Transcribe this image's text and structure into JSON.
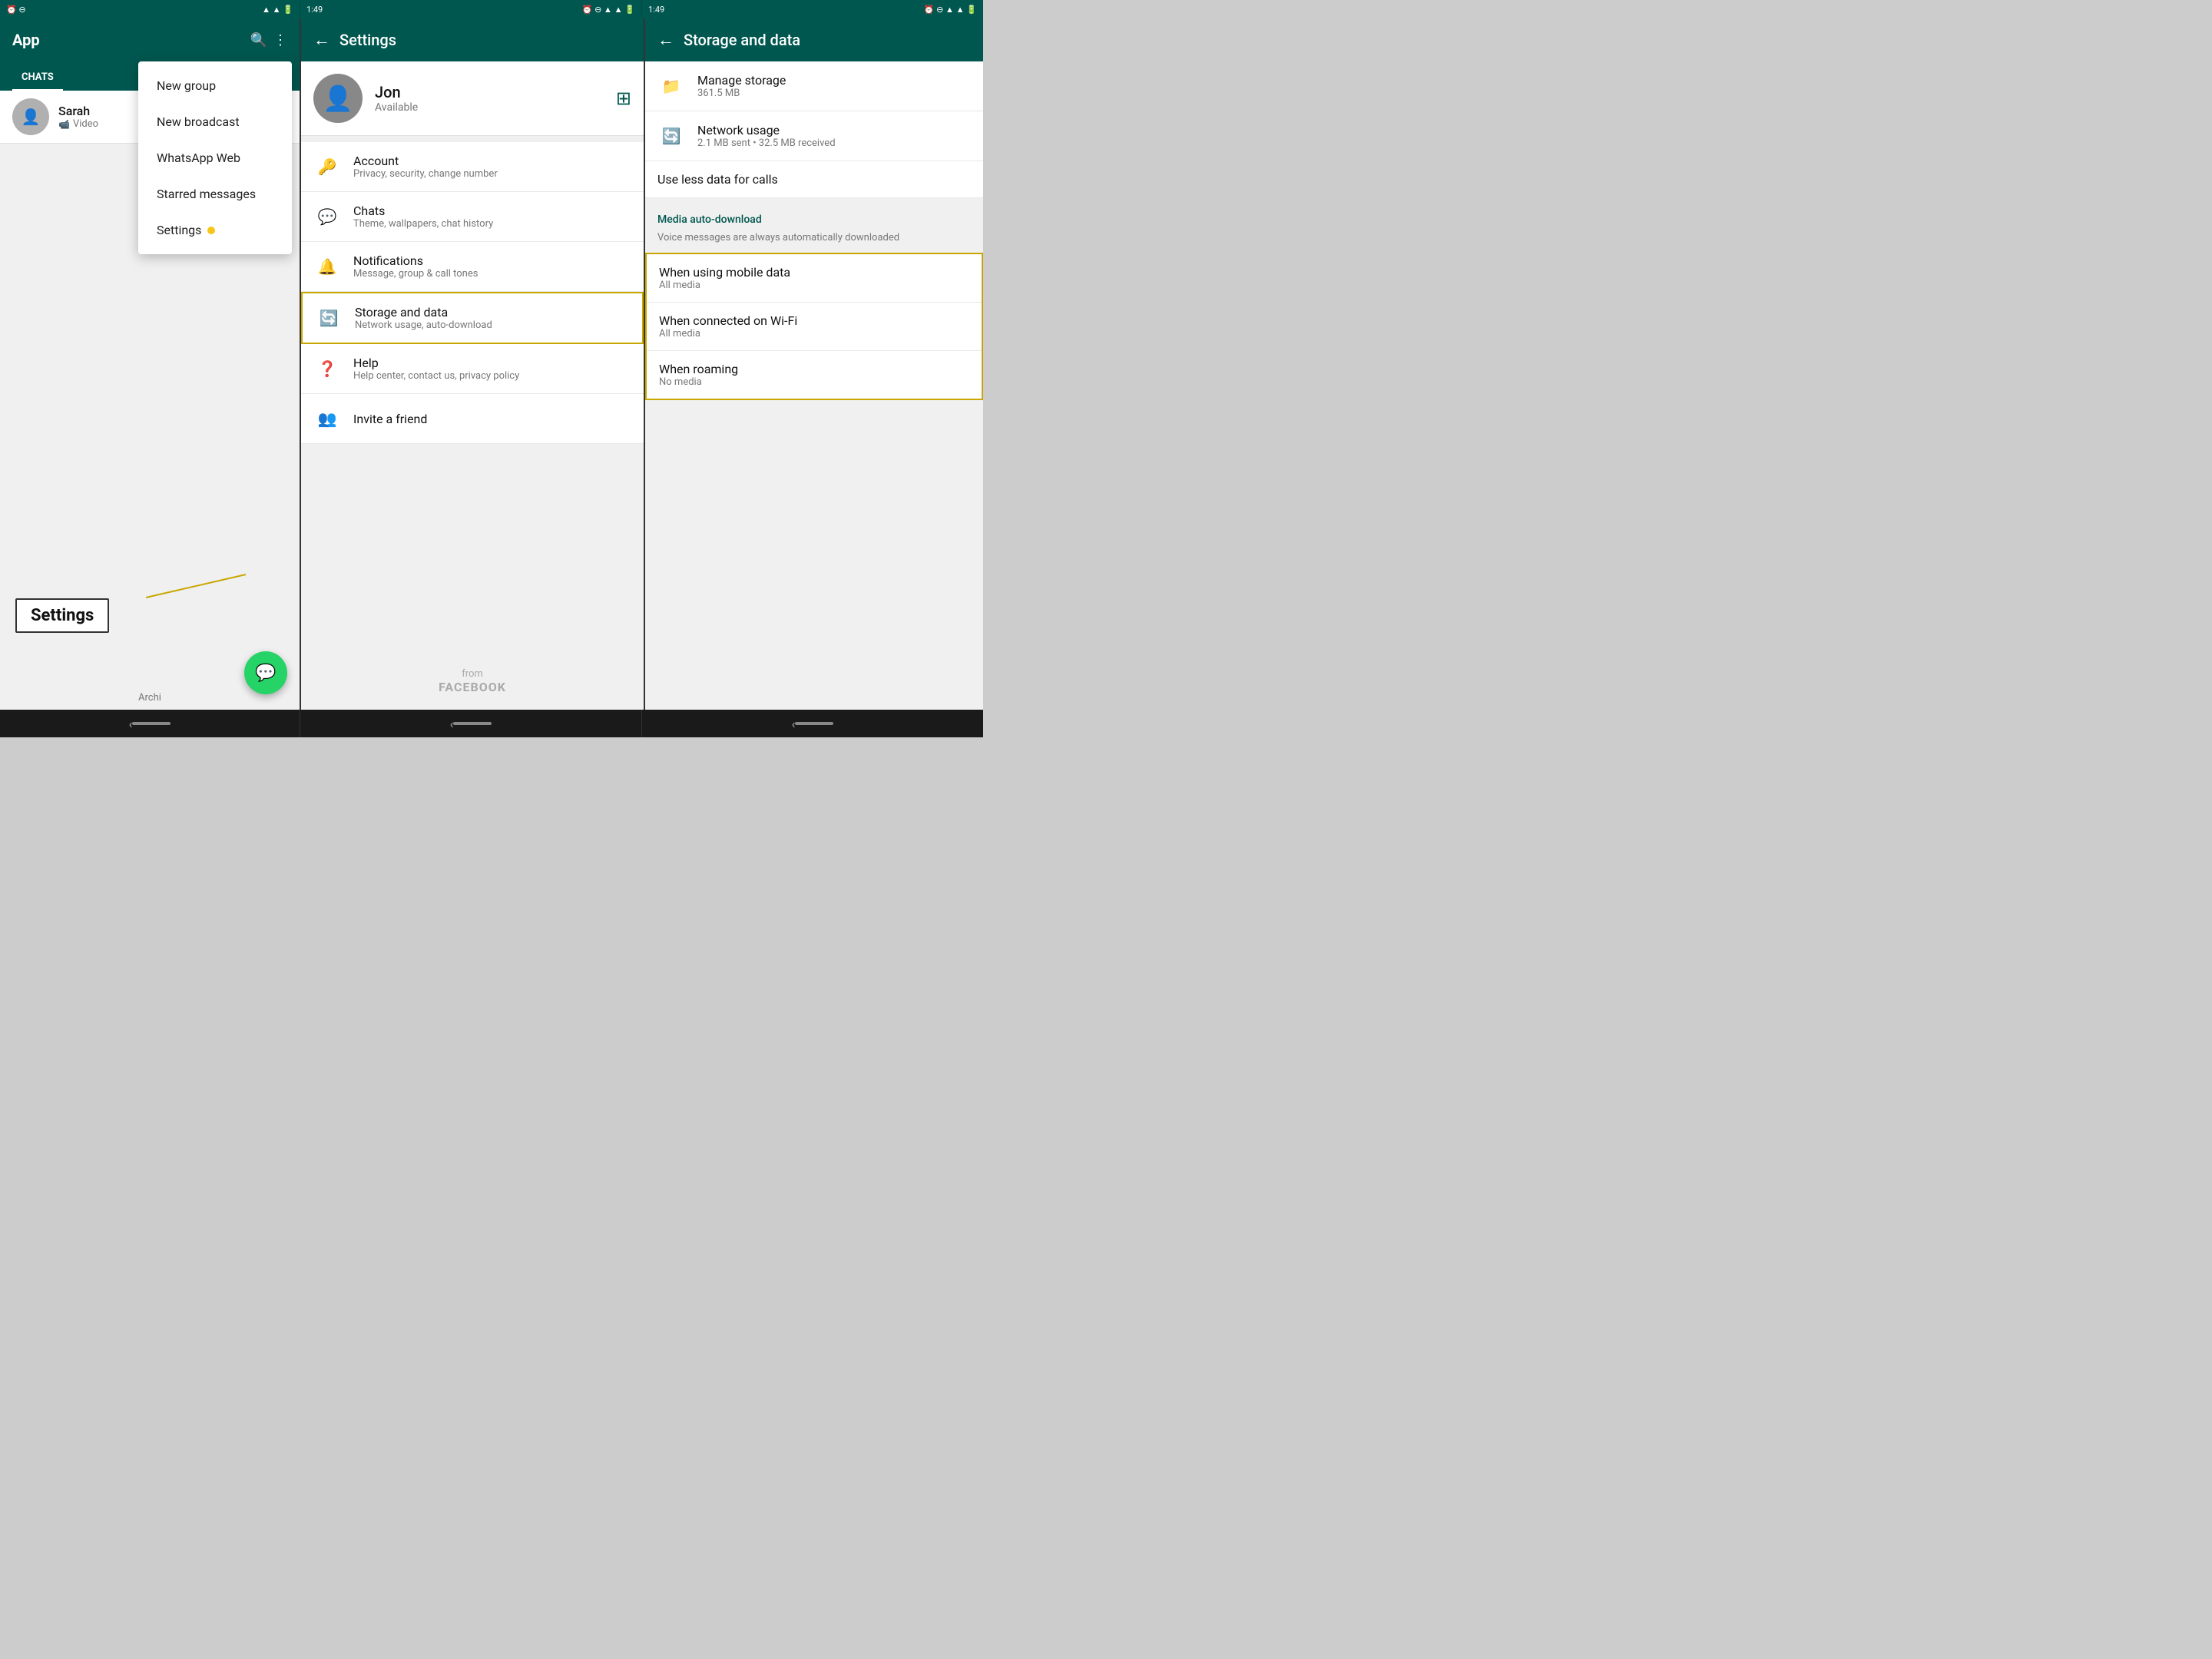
{
  "statusBar": {
    "time1": "",
    "time2": "1:49",
    "time3": "1:49",
    "icons": "⏰ ⊖ ▲ ▲"
  },
  "panel1": {
    "title": "App",
    "tab": "CHATS",
    "chats": [
      {
        "name": "Sarah",
        "preview": "Video",
        "hasVideoIcon": true
      }
    ],
    "archived": "Archi",
    "dropdown": {
      "items": [
        "New group",
        "New broadcast",
        "WhatsApp Web",
        "Starred messages",
        "Settings"
      ]
    },
    "fab": "💬",
    "callout": "Settings"
  },
  "panel2": {
    "title": "Settings",
    "profile": {
      "name": "Jon",
      "status": "Available"
    },
    "items": [
      {
        "icon": "🔑",
        "title": "Account",
        "subtitle": "Privacy, security, change number"
      },
      {
        "icon": "💬",
        "title": "Chats",
        "subtitle": "Theme, wallpapers, chat history"
      },
      {
        "icon": "🔔",
        "title": "Notifications",
        "subtitle": "Message, group & call tones"
      },
      {
        "icon": "🔄",
        "title": "Storage and data",
        "subtitle": "Network usage, auto-download",
        "highlighted": true
      },
      {
        "icon": "❓",
        "title": "Help",
        "subtitle": "Help center, contact us, privacy policy"
      },
      {
        "icon": "👥",
        "title": "Invite a friend",
        "subtitle": ""
      }
    ],
    "footer": {
      "from": "from",
      "brand": "FACEBOOK"
    }
  },
  "panel3": {
    "title": "Storage and data",
    "storageItems": [
      {
        "icon": "📁",
        "title": "Manage storage",
        "subtitle": "361.5 MB"
      },
      {
        "icon": "🔄",
        "title": "Network usage",
        "subtitle": "2.1 MB sent • 32.5 MB received"
      }
    ],
    "useLessData": "Use less data for calls",
    "mediaAutoDownload": {
      "label": "Media auto-download",
      "description": "Voice messages are always automatically downloaded",
      "items": [
        {
          "title": "When using mobile data",
          "subtitle": "All media"
        },
        {
          "title": "When connected on Wi-Fi",
          "subtitle": "All media"
        },
        {
          "title": "When roaming",
          "subtitle": "No media"
        }
      ]
    }
  },
  "bottomNav": {
    "segments": [
      "‹",
      "—",
      "‹",
      "—",
      "‹",
      "—"
    ]
  }
}
